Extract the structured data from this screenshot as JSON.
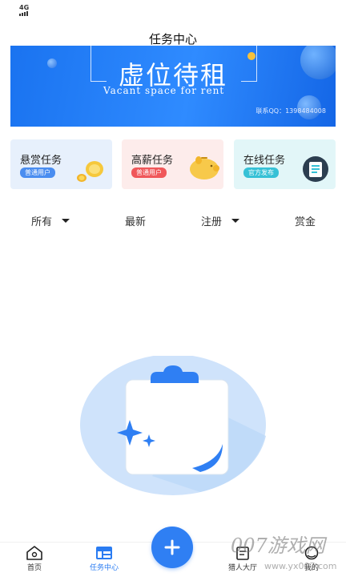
{
  "status_bar": {
    "network": "4G"
  },
  "header": {
    "title": "任务中心"
  },
  "banner": {
    "title": "虚位待租",
    "subtitle": "Vacant space for rent",
    "contact": "联系QQ：1398484008"
  },
  "task_cards": [
    {
      "title": "悬赏任务",
      "tag": "普通用户",
      "bg": "#e7f0fc",
      "tag_color": "#4a8df0"
    },
    {
      "title": "高薪任务",
      "tag": "普通用户",
      "bg": "#fdeceb",
      "tag_color": "#f0575a"
    },
    {
      "title": "在线任务",
      "tag": "官方发布",
      "bg": "#e2f6f8",
      "tag_color": "#36c1d6"
    }
  ],
  "filters": [
    {
      "label": "所有",
      "has_dropdown": true
    },
    {
      "label": "最新",
      "has_dropdown": false
    },
    {
      "label": "注册",
      "has_dropdown": true
    },
    {
      "label": "赏金",
      "has_dropdown": false
    }
  ],
  "bottom_nav": {
    "items": [
      {
        "label": "首页",
        "icon": "home-icon",
        "active": false
      },
      {
        "label": "任务中心",
        "icon": "task-center-icon",
        "active": true
      },
      {
        "label": "猎人大厅",
        "icon": "hunter-hall-icon",
        "active": false
      },
      {
        "label": "我的",
        "icon": "profile-icon",
        "active": false
      }
    ],
    "publish_icon": "plus-icon"
  },
  "watermark": {
    "text": "007游戏网",
    "sub": "www.yx007.com"
  },
  "colors": {
    "accent": "#2f7ff3",
    "banner": "#1a73f0"
  }
}
